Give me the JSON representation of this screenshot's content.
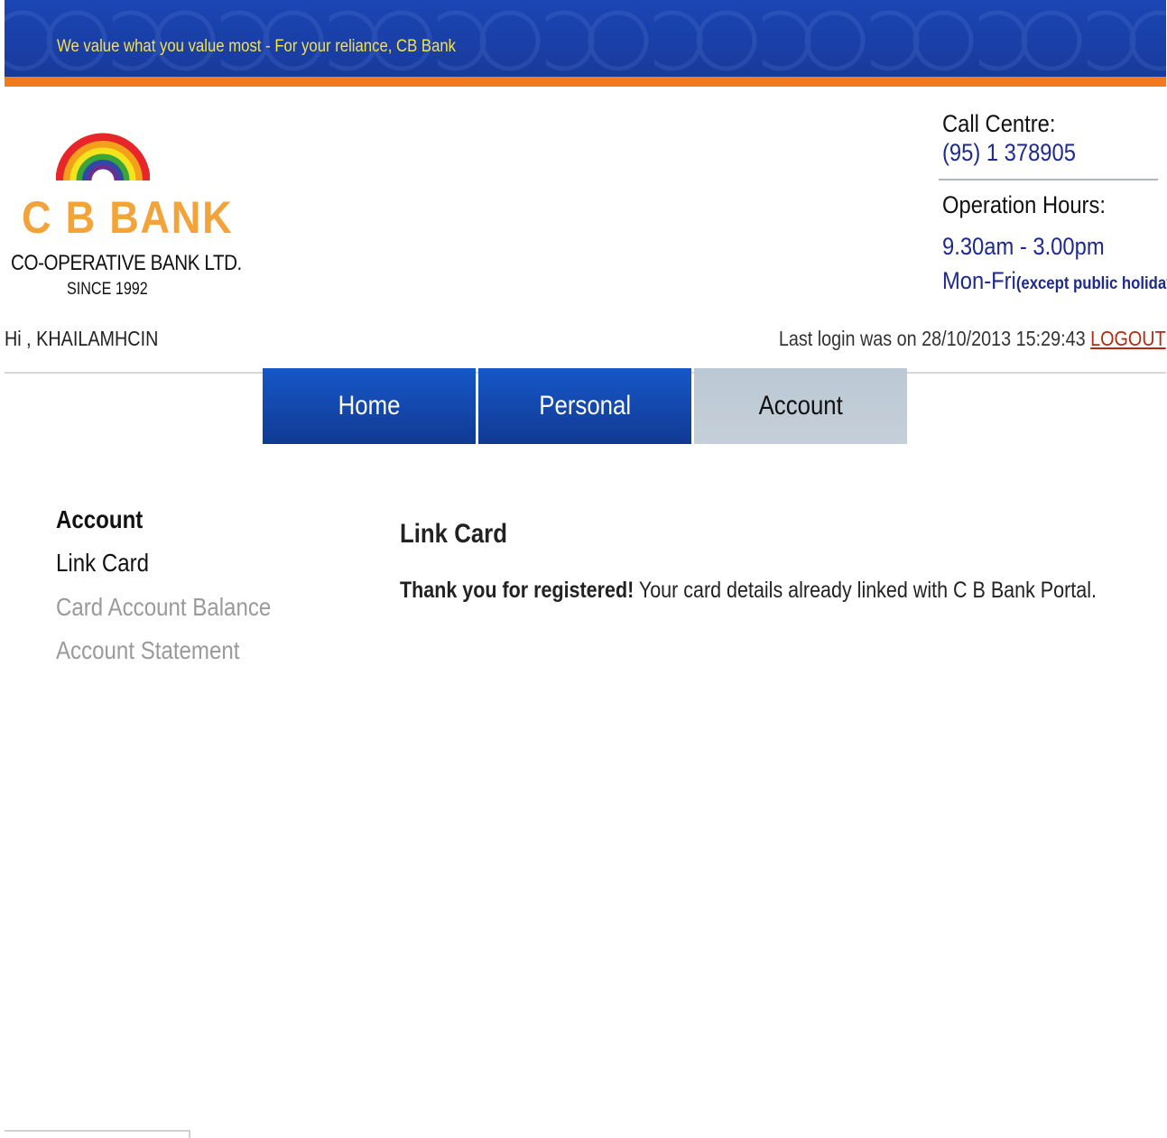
{
  "header": {
    "tagline": "We value what you value most - For your reliance, CB Bank"
  },
  "logo": {
    "brand": "C B BANK",
    "subname": "CO-OPERATIVE BANK LTD.",
    "since": "SINCE 1992",
    "rainbow_colors": [
      "#e8262a",
      "#f3a01a",
      "#f5e31c",
      "#3aa635",
      "#2f49a8",
      "#6a2f8e"
    ]
  },
  "contact": {
    "call_centre_label": "Call Centre:",
    "call_centre_phone": "(95) 1 378905",
    "hours_label": "Operation Hours:",
    "hours_time": "9.30am - 3.00pm",
    "hours_days": "Mon-Fri",
    "hours_note": "(except public holidays)"
  },
  "session": {
    "greeting": "Hi , KHAILAMHCIN",
    "last_login": "Last login was on 28/10/2013 15:29:43",
    "logout_label": "LOGOUT"
  },
  "nav": {
    "tabs": [
      {
        "label": "Home"
      },
      {
        "label": "Personal"
      },
      {
        "label": "Account"
      }
    ],
    "active_tab": "Account"
  },
  "sidebar": {
    "title": "Account",
    "items": [
      {
        "label": "Link Card"
      },
      {
        "label": "Card Account Balance"
      },
      {
        "label": "Account Statement"
      }
    ]
  },
  "main": {
    "title": "Link Card",
    "message_strong": "Thank you for registered!",
    "message_rest": "Your card details already linked with C B Bank Portal."
  },
  "colors": {
    "banner_blue": "#1a3fa6",
    "banner_stripe": "#f07a1c",
    "tab_blue": "#1447ab",
    "tab_active": "#c4cfd9",
    "logout_red": "#b32a10",
    "brand_orange": "#f2a33a"
  }
}
